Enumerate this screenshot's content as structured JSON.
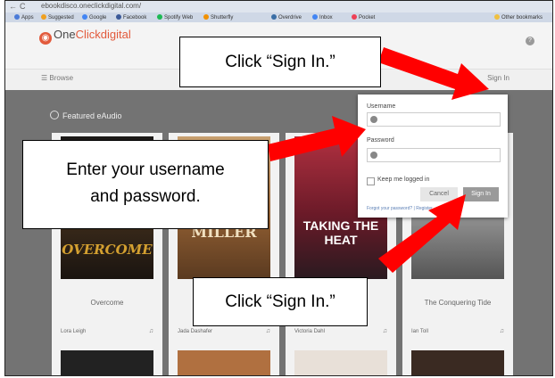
{
  "browser": {
    "url": "ebookdisco.oneclickdigital.com/",
    "bookmarks": [
      "Apps",
      "Suggested",
      "Google",
      "Facebook",
      "Spotify Web",
      "Shutterfly",
      "Overdrive",
      "Inbox",
      "Pocket"
    ],
    "other_bookmarks": "Other bookmarks"
  },
  "app": {
    "brand_prefix": "One",
    "brand_name": "Clickdigital",
    "browse": "Browse",
    "sign_in_link": "Sign In",
    "featured": "Featured eAudio",
    "colors": {
      "brand": "#e25a3c",
      "arrow": "#ff0000"
    }
  },
  "books": [
    {
      "title": "Overcome",
      "author": "Lora Leigh",
      "cover_text": "OVERCOME"
    },
    {
      "title": "",
      "author": "Jada Dashafer",
      "cover_text": "MILLER"
    },
    {
      "title": "",
      "author": "Victoria Dahl",
      "cover_text": "TAKING THE HEAT"
    },
    {
      "title": "The Conquering Tide",
      "author": "Ian Toll",
      "cover_text": ""
    }
  ],
  "login": {
    "username_label": "Username",
    "password_label": "Password",
    "keep_logged_in": "Keep me logged in",
    "cancel": "Cancel",
    "sign_in": "Sign In",
    "forgot": "Forgot your password? | Register"
  },
  "callouts": {
    "top": "Click “Sign In.”",
    "middle_line1": "Enter your username",
    "middle_line2": "and password.",
    "bottom": "Click “Sign In.”"
  }
}
